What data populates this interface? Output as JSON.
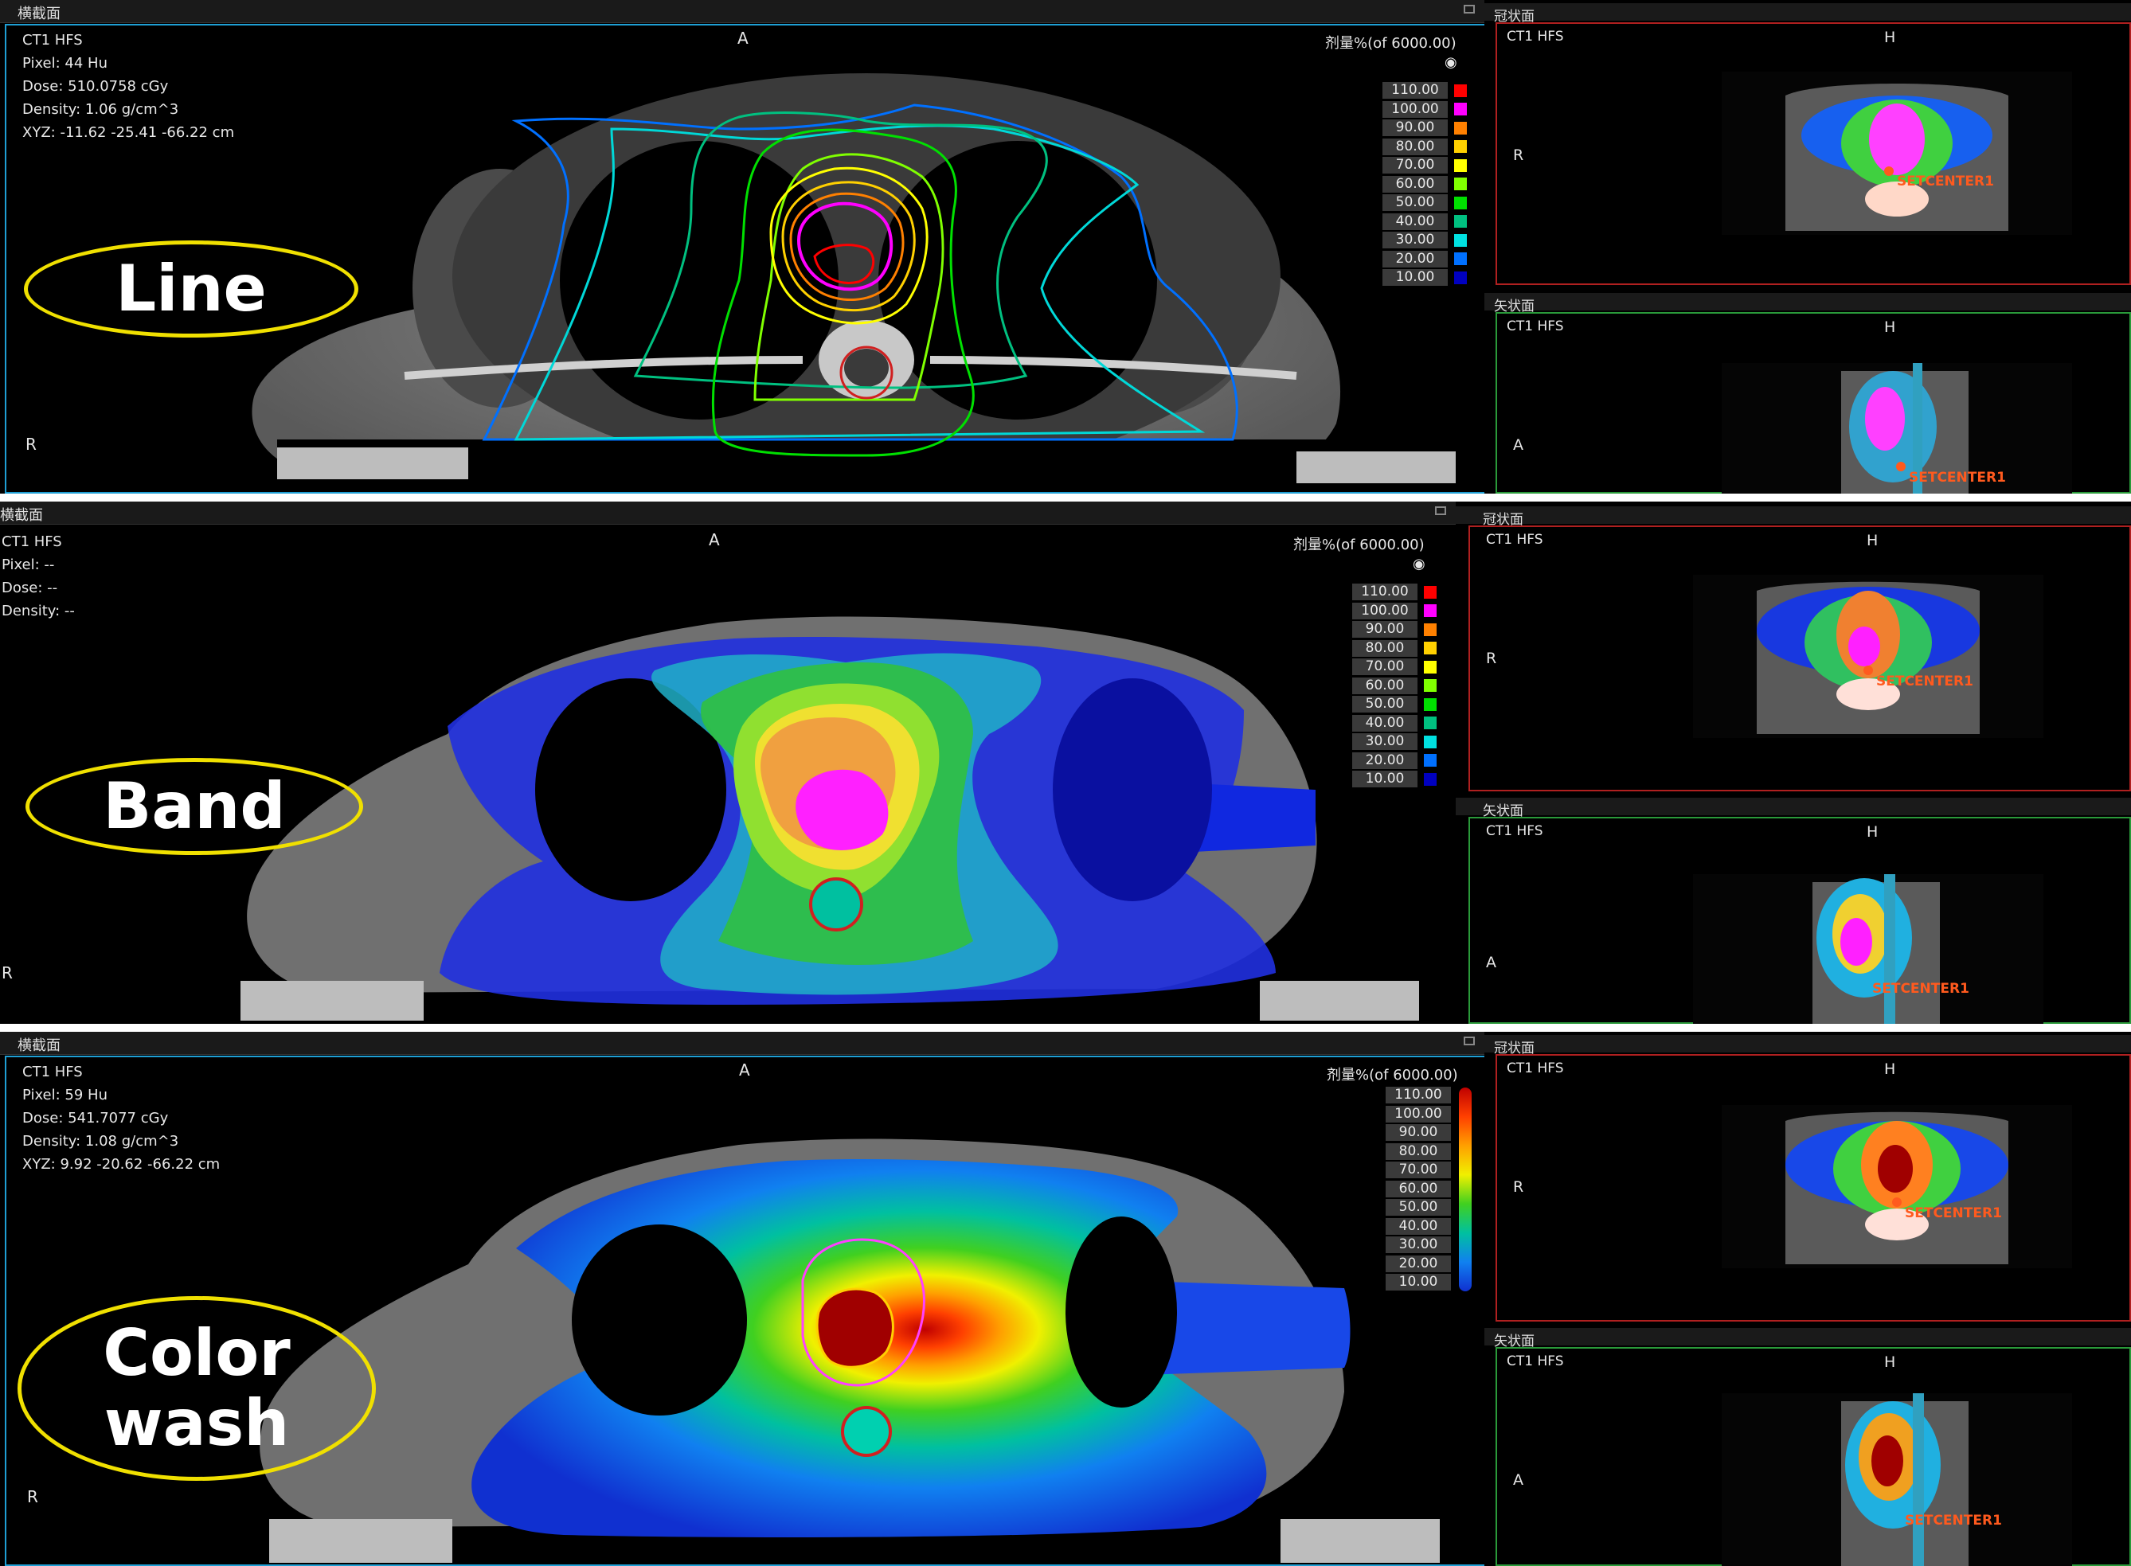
{
  "panels": [
    {
      "mode_callout": "Line",
      "axial": {
        "view_title": "横截面",
        "image_set": "CT1 HFS",
        "pixel": "Pixel:  44 Hu",
        "dose": "Dose:  510.0758 cGy",
        "density": "Density:  1.06 g/cm^3",
        "xyz": "XYZ: -11.62 -25.41 -66.22 cm",
        "orient_top": "A",
        "orient_left": "R",
        "dose_header": "剂量%(of 6000.00)"
      },
      "coronal": {
        "view_title": "冠状面",
        "image_set": "CT1 HFS",
        "orient_top": "H",
        "orient_left": "R",
        "isocenter": "SETCENTER1"
      },
      "sagittal": {
        "view_title": "矢状面",
        "image_set": "CT1 HFS",
        "orient_top": "H",
        "orient_left": "A",
        "isocenter": "SETCENTER1"
      }
    },
    {
      "mode_callout": "Band",
      "axial": {
        "view_title": "横截面",
        "image_set": "CT1 HFS",
        "pixel": "Pixel:  --",
        "dose": "Dose:  --",
        "density": "Density:  --",
        "xyz": "",
        "orient_top": "A",
        "orient_left": "R",
        "dose_header": "剂量%(of 6000.00)"
      },
      "coronal": {
        "view_title": "冠状面",
        "image_set": "CT1 HFS",
        "orient_top": "H",
        "orient_left": "R",
        "isocenter": "SETCENTER1"
      },
      "sagittal": {
        "view_title": "矢状面",
        "image_set": "CT1 HFS",
        "orient_top": "H",
        "orient_left": "A",
        "isocenter": "SETCENTER1"
      }
    },
    {
      "mode_callout": "Color wash",
      "axial": {
        "view_title": "横截面",
        "image_set": "CT1 HFS",
        "pixel": "Pixel:  59 Hu",
        "dose": "Dose:  541.7077 cGy",
        "density": "Density:  1.08 g/cm^3",
        "xyz": "XYZ: 9.92 -20.62 -66.22 cm",
        "orient_top": "A",
        "orient_left": "R",
        "dose_header": "剂量%(of 6000.00)"
      },
      "coronal": {
        "view_title": "冠状面",
        "image_set": "CT1 HFS",
        "orient_top": "H",
        "orient_left": "R",
        "isocenter": "SETCENTER1"
      },
      "sagittal": {
        "view_title": "矢状面",
        "image_set": "CT1 HFS",
        "orient_top": "H",
        "orient_left": "A",
        "isocenter": "SETCENTER1"
      }
    }
  ],
  "isodose_levels": [
    {
      "label": "110.00",
      "color": "#ff0000"
    },
    {
      "label": "100.00",
      "color": "#ff00ff"
    },
    {
      "label": "90.00",
      "color": "#ff8000"
    },
    {
      "label": "80.00",
      "color": "#ffd000"
    },
    {
      "label": "70.00",
      "color": "#ffff00"
    },
    {
      "label": "60.00",
      "color": "#80ff00"
    },
    {
      "label": "50.00",
      "color": "#00e000"
    },
    {
      "label": "40.00",
      "color": "#00c080"
    },
    {
      "label": "30.00",
      "color": "#00e0e0"
    },
    {
      "label": "20.00",
      "color": "#0070ff"
    },
    {
      "label": "10.00",
      "color": "#0000c0"
    }
  ]
}
